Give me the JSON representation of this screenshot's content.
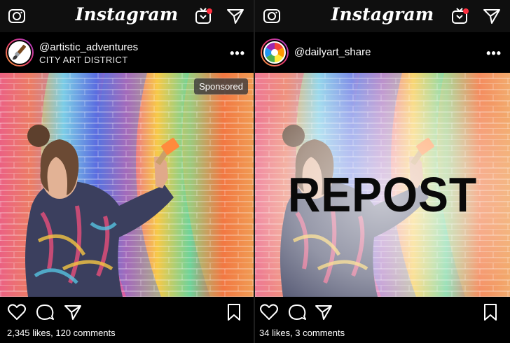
{
  "left_post": {
    "app_title": "Instagram",
    "username": "@artistic_adventures",
    "location": "CITY ART DISTRICT",
    "more_label": "•••",
    "sponsored_label": "Sponsored",
    "stats": "2,345 likes, 120 comments"
  },
  "right_post": {
    "app_title": "Instagram",
    "username": "@dailyart_share",
    "more_label": "•••",
    "overlay_text": "REPOST",
    "stats": "34 likes, 3 comments"
  },
  "icons": {
    "camera": "camera-icon",
    "igtv": "igtv-icon",
    "direct": "paper-plane-icon",
    "like": "heart-icon",
    "comment": "comment-icon",
    "share": "share-icon",
    "save": "bookmark-icon",
    "avatar_left": "paintbrush-icon",
    "avatar_right": "color-wheel-icon"
  },
  "colors": {
    "background": "#000000",
    "topbar": "#0f0f0f",
    "notification_dot": "#ff3040",
    "story_ring_start": "#f9a23b",
    "story_ring_end": "#a23bd6"
  }
}
